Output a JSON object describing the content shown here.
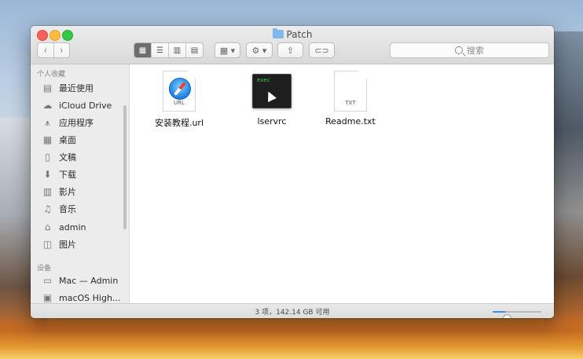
{
  "window": {
    "title": "Patch"
  },
  "toolbar": {
    "back": "‹",
    "forward": "›",
    "view_icons": "▦",
    "view_list": "☰",
    "view_columns": "▥",
    "view_coverflow": "▤",
    "arrange": "▦ ▾",
    "action": "⚙ ▾",
    "share": "⇪",
    "tag": "⊂⊃",
    "search_label": "搜索"
  },
  "sidebar": {
    "favorites_header": "个人收藏",
    "favorites": [
      {
        "label": "最近使用",
        "icon": "recents-icon"
      },
      {
        "label": "iCloud Drive",
        "icon": "cloud-icon"
      },
      {
        "label": "应用程序",
        "icon": "applications-icon"
      },
      {
        "label": "桌面",
        "icon": "desktop-icon"
      },
      {
        "label": "文稿",
        "icon": "documents-icon"
      },
      {
        "label": "下载",
        "icon": "downloads-icon"
      },
      {
        "label": "影片",
        "icon": "movies-icon"
      },
      {
        "label": "音乐",
        "icon": "music-icon"
      },
      {
        "label": "admin",
        "icon": "home-icon"
      },
      {
        "label": "图片",
        "icon": "pictures-icon"
      }
    ],
    "devices_header": "设备",
    "devices": [
      {
        "label": "Mac — Admin",
        "icon": "computer-icon"
      },
      {
        "label": "macOS High...",
        "icon": "disk-icon"
      }
    ]
  },
  "files": [
    {
      "name": "安装教程.url",
      "type_tag": "URL",
      "icon": "safari-url-icon"
    },
    {
      "name": "lservrc",
      "type_tag": "exec",
      "icon": "terminal-exec-icon"
    },
    {
      "name": "Readme.txt",
      "type_tag": "TXT",
      "icon": "text-file-icon"
    }
  ],
  "status": {
    "text": "3 项，142.14 GB 可用",
    "zoom_level": 0.25
  },
  "colors": {
    "accent": "#3f8ee6",
    "exec_text": "#3ed15a"
  }
}
